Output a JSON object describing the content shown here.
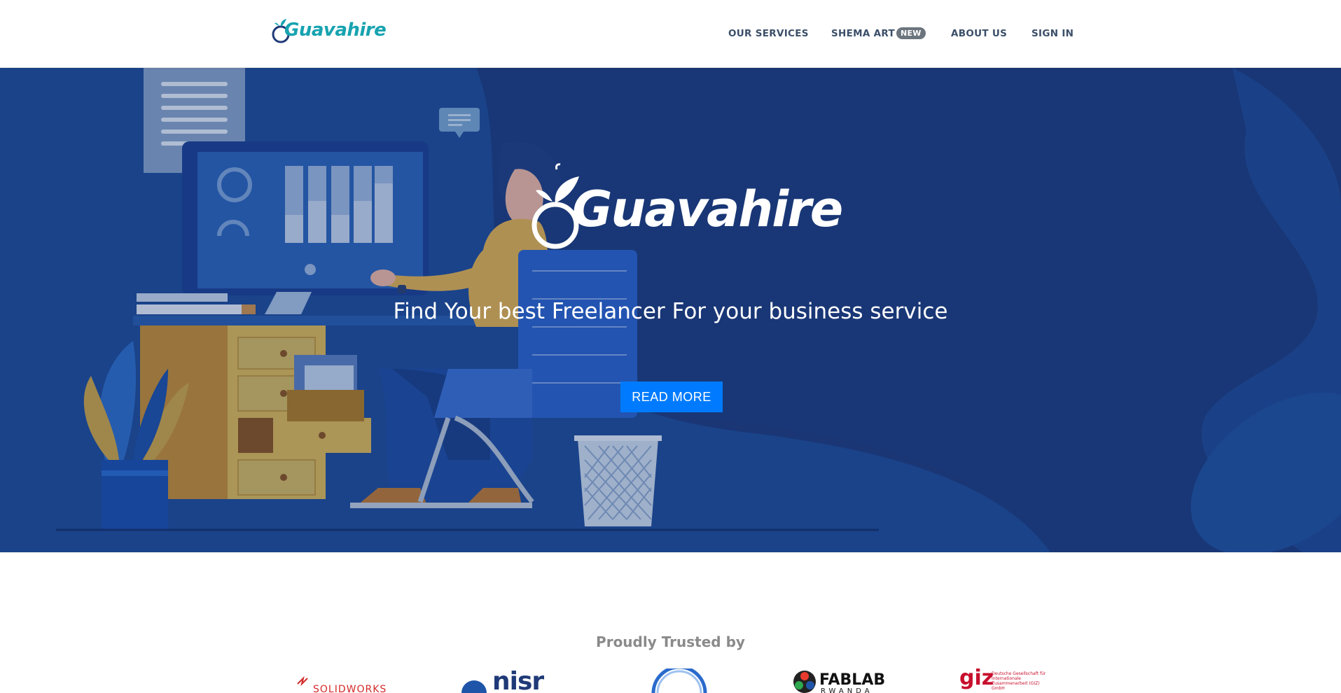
{
  "nav": {
    "brand": "Guavahire",
    "links": [
      {
        "label": "OUR SERVICES"
      },
      {
        "label": "SHEMA ART",
        "badge": "NEW"
      },
      {
        "label": "ABOUT US"
      },
      {
        "label": "SIGN IN"
      }
    ]
  },
  "hero": {
    "brand": "Guavahire",
    "subtitle": "Find Your best Freelancer For your business service",
    "cta_label": "READ MORE"
  },
  "trusted": {
    "title": "Proudly Trusted by",
    "partners": [
      {
        "name": "SolidWorks",
        "text": "SOLIDWORKS"
      },
      {
        "name": "NISR",
        "text": "nisr"
      },
      {
        "name": "partner-ring-logo",
        "text": ""
      },
      {
        "name": "FabLab Rwanda",
        "text": "FABLAB",
        "subtext": "RWANDA"
      },
      {
        "name": "GIZ",
        "text": "giz",
        "subtext": "Deutsche Gesellschaft für Internationale Zusammenarbeit (GIZ) GmbH"
      }
    ]
  },
  "colors": {
    "brand_teal": "#17a3b0",
    "brand_navy": "#1f3a78",
    "hero_bg": "#1f3a78",
    "primary_button": "#007bff",
    "nav_text": "#3b4f68",
    "badge_bg": "#6c757d"
  }
}
